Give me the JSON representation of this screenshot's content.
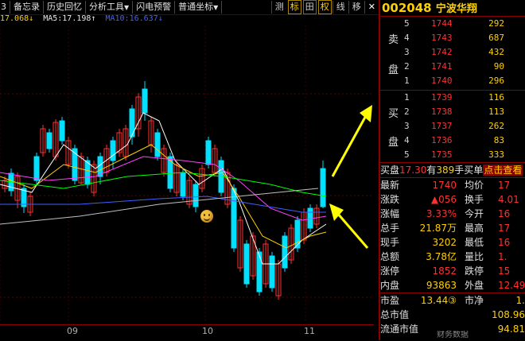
{
  "toolbar": {
    "items": [
      "备忘录",
      "历史回忆",
      "分析工具",
      "闪电预警",
      "普通坐标"
    ],
    "arrows": [
      "▼",
      "▼"
    ],
    "right_buttons": [
      "测",
      "标",
      "田",
      "权",
      "线",
      "移"
    ],
    "lead": "3"
  },
  "ma": {
    "first": "17.068↓",
    "ma5_label": "MA5:",
    "ma5_value": "17.198↑",
    "ma10_label": "MA10:",
    "ma10_value": "16.637↓"
  },
  "xaxis": {
    "labels": [
      "09",
      "10",
      "11"
    ]
  },
  "quote": {
    "code": "002048",
    "name": "宁波华翔",
    "sell_label_1": "卖",
    "sell_label_2": "盘",
    "buy_label_1": "买",
    "buy_label_2": "盘",
    "asks": [
      {
        "level": "5",
        "price": "1744",
        "vol": "292"
      },
      {
        "level": "4",
        "price": "1743",
        "vol": "687"
      },
      {
        "level": "3",
        "price": "1742",
        "vol": "432"
      },
      {
        "level": "2",
        "price": "1741",
        "vol": "90"
      },
      {
        "level": "1",
        "price": "1740",
        "vol": "296"
      }
    ],
    "bids": [
      {
        "level": "1",
        "price": "1739",
        "vol": "116"
      },
      {
        "level": "2",
        "price": "1738",
        "vol": "113"
      },
      {
        "level": "3",
        "price": "1737",
        "vol": "262"
      },
      {
        "level": "4",
        "price": "1736",
        "vol": "83"
      },
      {
        "level": "5",
        "price": "1735",
        "vol": "333"
      }
    ],
    "trade": {
      "buy_label": "买盘",
      "price": "17.30",
      "have": "有",
      "qty": "389",
      "unit": "手买单",
      "link": "点击查看"
    },
    "stats": [
      {
        "l1": "最新",
        "v1": "1740",
        "c1": "red",
        "l2": "均价",
        "v2": "17"
      },
      {
        "l1": "涨跌",
        "v1": "▲056",
        "c1": "red",
        "l2": "换手",
        "v2": "4.01"
      },
      {
        "l1": "涨幅",
        "v1": "3.33%",
        "c1": "red",
        "l2": "今开",
        "v2": "16"
      },
      {
        "l1": "总手",
        "v1": "21.87万",
        "c1": "yellow",
        "l2": "最高",
        "v2": "17"
      },
      {
        "l1": "现手",
        "v1": "3202",
        "c1": "yellow",
        "l2": "最低",
        "v2": "16"
      },
      {
        "l1": "总额",
        "v1": "3.78亿",
        "c1": "yellow",
        "l2": "量比",
        "v2": "1."
      },
      {
        "l1": "涨停",
        "v1": "1852",
        "c1": "red",
        "l2": "跌停",
        "v2": "15"
      },
      {
        "l1": "内盘",
        "v1": "93863",
        "c1": "yellow",
        "l2": "外盘",
        "v2": "12.49"
      }
    ],
    "stats2": [
      {
        "l1": "市盈",
        "v1": "13.44③",
        "l2": "市净",
        "v2": "1."
      },
      {
        "l1": "总市值",
        "v1": "",
        "l2": "",
        "v2": "108.96"
      },
      {
        "l1": "流通市值",
        "v1": "",
        "l2": "",
        "v2": "94.81"
      }
    ],
    "bottom": "财务数据"
  },
  "colors": {
    "up": "#ff3030",
    "down": "#00e0ff",
    "ma5": "#ffffff",
    "ma10": "#ffd000",
    "ma20": "#ff40ff",
    "ma60": "#00ff00",
    "arrow": "#ffff00"
  }
}
